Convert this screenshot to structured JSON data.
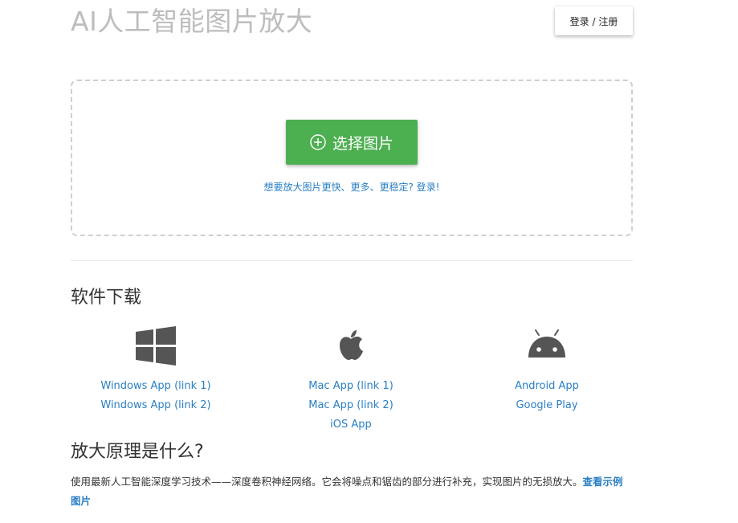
{
  "header": {
    "title": "AI人工智能图片放大",
    "login_label": "登录 / 注册"
  },
  "upload": {
    "select_label": "选择图片",
    "hint": "想要放大图片更快、更多、更稳定? 登录!"
  },
  "downloads": {
    "heading": "软件下载",
    "windows": {
      "icon": "windows-icon",
      "links": [
        "Windows App (link 1)",
        "Windows App (link 2)"
      ]
    },
    "mac": {
      "icon": "apple-icon",
      "links": [
        "Mac App (link 1)",
        "Mac App (link 2)",
        "iOS App"
      ]
    },
    "android": {
      "icon": "android-icon",
      "links": [
        "Android App",
        "Google Play"
      ]
    }
  },
  "principle": {
    "heading": "放大原理是什么?",
    "text": "使用最新人工智能深度学习技术——深度卷积神经网络。它会将噪点和锯齿的部分进行补充，实现图片的无损放大。",
    "link": "查看示例图片"
  },
  "colors": {
    "accent_green": "#4caf50",
    "link_blue": "#2a7fc4",
    "title_gray": "#bdbdbd"
  }
}
